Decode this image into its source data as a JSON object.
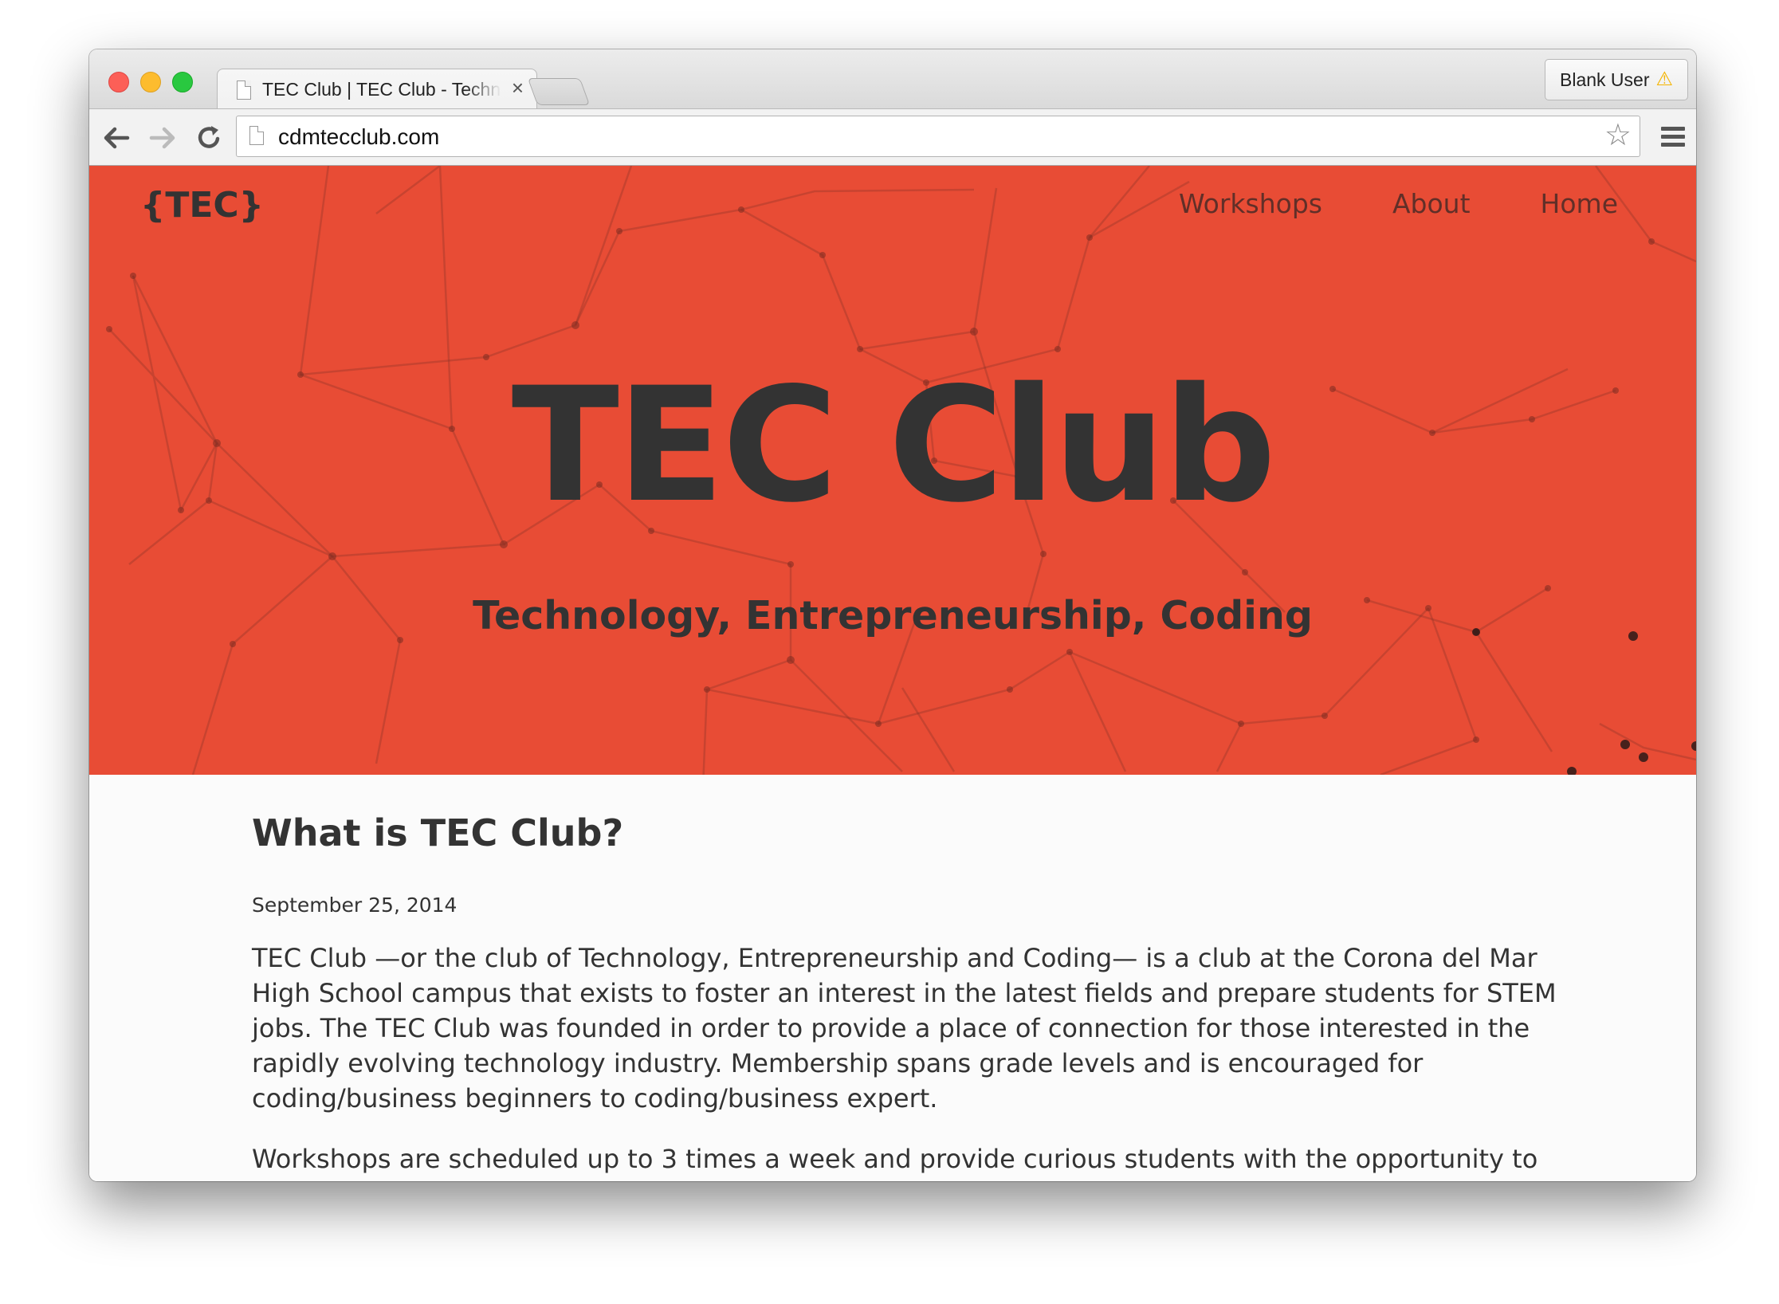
{
  "browser": {
    "tab_title": "TEC Club | TEC Club - Technology, Entrepreneurship, Coding",
    "tab_close": "×",
    "profile_label": "Blank User",
    "profile_warning_icon": "warning-icon",
    "address": "cdmtecclub.com",
    "icons": {
      "back": "back-arrow-icon",
      "forward": "forward-arrow-icon",
      "reload": "reload-icon",
      "bookmark": "star-icon",
      "menu": "hamburger-menu-icon"
    }
  },
  "site": {
    "logo": "{TEC}",
    "nav": [
      {
        "label": "Workshops"
      },
      {
        "label": "About"
      },
      {
        "label": "Home"
      }
    ],
    "hero": {
      "title": "TEC Club",
      "subtitle": "Technology, Entrepreneurship, Coding",
      "background_color": "#e84c35"
    },
    "post": {
      "title": "What is TEC Club?",
      "date": "September 25, 2014",
      "paragraphs": [
        "TEC Club —or the club of Technology, Entrepreneurship and Coding— is a club at the Corona del Mar High School campus that exists to foster an interest in the latest fields and prepare students for STEM jobs. The TEC Club was founded in order to provide a place of connection for those interested in the rapidly evolving technology industry. Membership spans grade levels and is encouraged for coding/business beginners to coding/business expert.",
        "Workshops are scheduled up to 3 times a week and provide curious students with the opportunity to"
      ]
    }
  }
}
